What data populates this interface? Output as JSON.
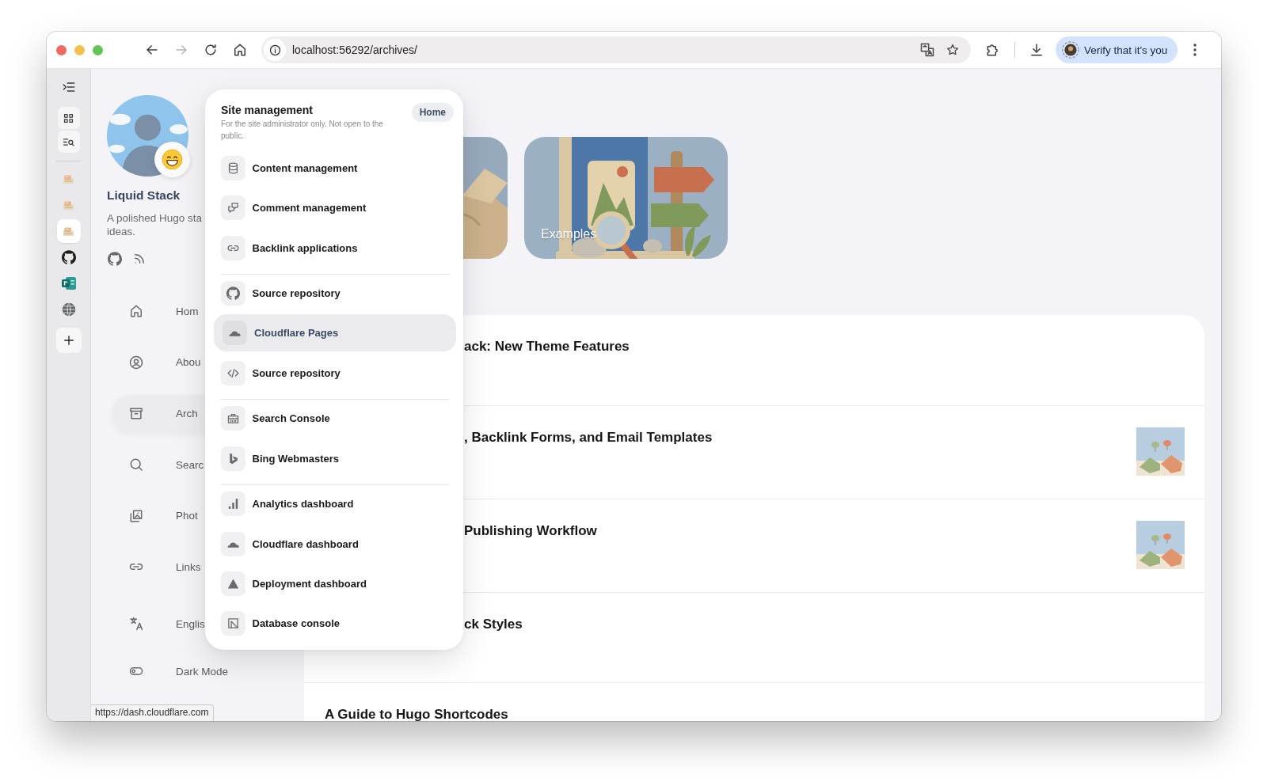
{
  "window_controls": [
    {
      "kind": "close"
    },
    {
      "kind": "minimize"
    },
    {
      "kind": "maximize"
    }
  ],
  "nav_buttons": [
    {
      "kind": "back",
      "disabled": false
    },
    {
      "kind": "forward",
      "disabled": true
    },
    {
      "kind": "reload",
      "disabled": false
    },
    {
      "kind": "home",
      "disabled": false
    }
  ],
  "address_bar": {
    "url": "localhost:56292/archives/"
  },
  "profile_button": {
    "label": "Verify that it's you"
  },
  "vertical_tabs": [
    {
      "kind": "site",
      "selected": false
    },
    {
      "kind": "site",
      "selected": false
    },
    {
      "kind": "site",
      "selected": true
    },
    {
      "kind": "github",
      "selected": false
    },
    {
      "kind": "app",
      "selected": false
    },
    {
      "kind": "globe",
      "selected": false
    }
  ],
  "site_sidebar": {
    "title": "Liquid Stack",
    "description_lines": [
      "A polished Hugo sta",
      "ideas."
    ],
    "social_links": [
      {
        "kind": "github"
      },
      {
        "kind": "rss"
      }
    ],
    "nav_items": [
      {
        "kind": "home",
        "label": "Hom",
        "selected": false
      },
      {
        "kind": "person",
        "label": "Abou",
        "selected": false
      },
      {
        "kind": "archive",
        "label": "Arch",
        "selected": true
      },
      {
        "kind": "search",
        "label": "Searc",
        "selected": false
      },
      {
        "kind": "photos",
        "label": "Phot",
        "selected": false
      },
      {
        "kind": "link",
        "label": "Links",
        "selected": false
      }
    ],
    "settings_items": [
      {
        "kind": "language",
        "label": "Englis"
      },
      {
        "kind": "toggle",
        "label": "Dark Mode"
      }
    ]
  },
  "category_cards": [
    {
      "kind": "box",
      "covered": true
    },
    {
      "kind": "signpost",
      "label": "Examples",
      "covered": false
    }
  ],
  "posts": [
    {
      "title": "ack: New Theme Features",
      "covered": true,
      "thumbnail": false
    },
    {
      "title": ", Backlink Forms, and Email Templates",
      "covered": true,
      "thumbnail": true
    },
    {
      "title": "Publishing Workflow",
      "covered": true,
      "thumbnail": true
    },
    {
      "title": "ck Styles",
      "covered": true,
      "thumbnail": false
    },
    {
      "title": "A Guide to Hugo Shortcodes",
      "covered": false,
      "thumbnail": false
    }
  ],
  "admin_menu": {
    "title": "Site management",
    "description": "For the site administrator only. Not open to the public.",
    "home_button": "Home",
    "sections": [
      {
        "items": [
          {
            "kind": "database",
            "label": "Content management",
            "selected": false
          },
          {
            "kind": "comments",
            "label": "Comment management",
            "selected": false
          },
          {
            "kind": "link",
            "label": "Backlink applications",
            "selected": false
          }
        ]
      },
      {
        "items": [
          {
            "kind": "github",
            "label": "Source repository",
            "selected": false
          },
          {
            "kind": "cloud",
            "label": "Cloudflare Pages",
            "selected": true
          },
          {
            "kind": "code",
            "label": "Source repository",
            "selected": false
          }
        ]
      },
      {
        "items": [
          {
            "kind": "briefcase",
            "label": "Search Console",
            "selected": false
          },
          {
            "kind": "bing",
            "label": "Bing Webmasters",
            "selected": false
          }
        ]
      },
      {
        "items": [
          {
            "kind": "bars",
            "label": "Analytics dashboard",
            "selected": false
          },
          {
            "kind": "cloud",
            "label": "Cloudflare dashboard",
            "selected": false
          },
          {
            "kind": "triangle",
            "label": "Deployment dashboard",
            "selected": false
          },
          {
            "kind": "console",
            "label": "Database console",
            "selected": false
          }
        ]
      }
    ]
  },
  "status_bar": {
    "url": "https://dash.cloudflare.com"
  }
}
